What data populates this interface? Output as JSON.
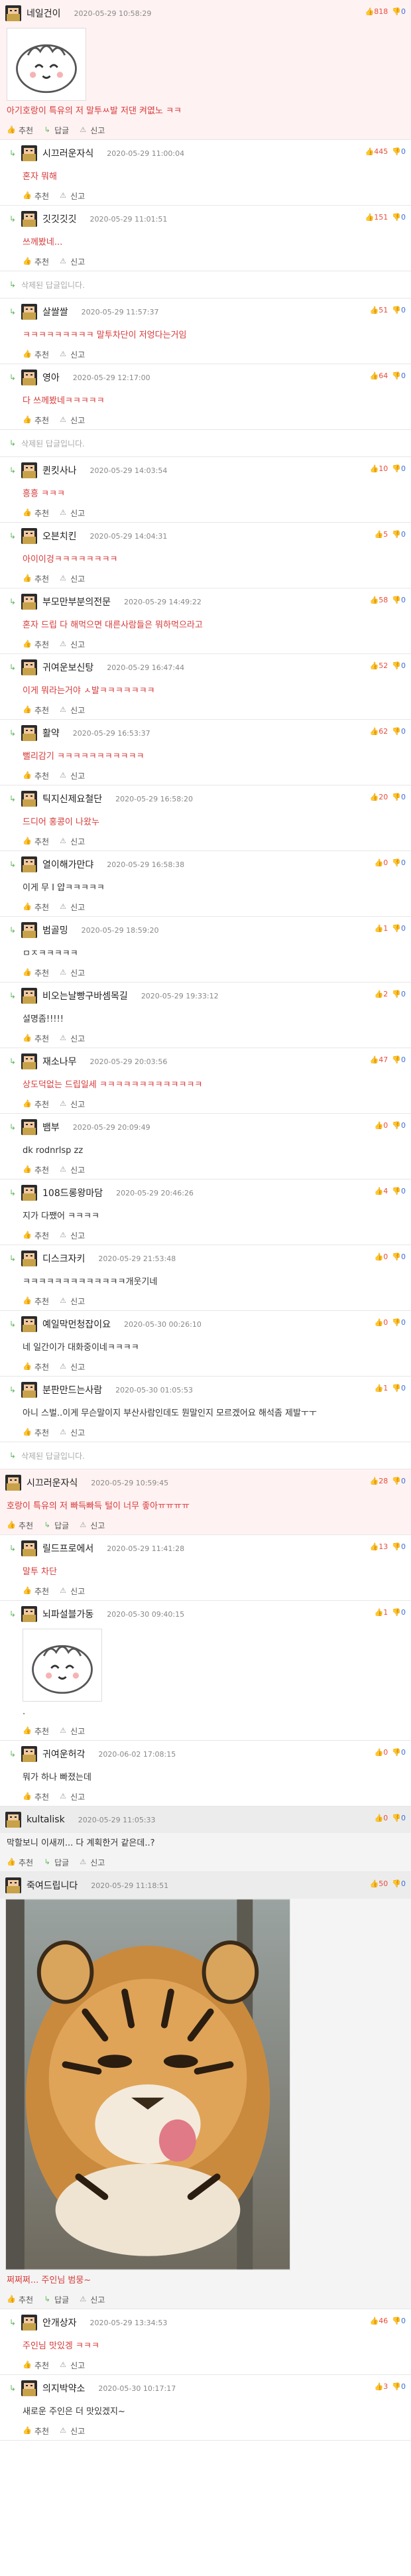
{
  "labels": {
    "recommend": "추천",
    "reply": "답글",
    "report": "신고",
    "deleted": "삭제된 답글입니다."
  },
  "colors": {
    "best_bg": "#fff2f2",
    "top_bg": "#f4f4f4",
    "up": "#e74c3c",
    "down": "#3a6fd8",
    "deleted_text": "#aaa"
  },
  "blocks": [
    {
      "kind": "comment",
      "variant": "best",
      "nick": "네일건이",
      "date": "2020-05-29 10:58:29",
      "score_up": "818",
      "score_down": "0",
      "image": "dumpling-sticker",
      "text": "아기호랑이 특유의 저 말투ㅆ발 저댄 켜엾노 ㅋㅋ",
      "text_color": "#d63a3a",
      "actions": "rec-reply-report"
    },
    {
      "kind": "comment",
      "variant": "reply",
      "nick": "시끄러운자식",
      "date": "2020-05-29 11:00:04",
      "score_up": "445",
      "score_down": "0",
      "text": "혼자 뭐해",
      "text_color": "#d63a3a",
      "actions": "rec-report"
    },
    {
      "kind": "comment",
      "variant": "reply",
      "nick": "깃깃깃깃",
      "date": "2020-05-29 11:01:51",
      "score_up": "151",
      "score_down": "0",
      "text": "쓰께봤네...",
      "text_color": "#d63a3a",
      "actions": "rec-report"
    },
    {
      "kind": "deleted",
      "variant": "reply"
    },
    {
      "kind": "comment",
      "variant": "reply",
      "nick": "살쌀쌀",
      "date": "2020-05-29 11:57:37",
      "score_up": "51",
      "score_down": "0",
      "text": "ㅋㅋㅋㅋㅋㅋㅋㅋㅋ 말투차단이 저엉다는거임",
      "text_color": "#d63a3a",
      "actions": "rec-report"
    },
    {
      "kind": "comment",
      "variant": "reply",
      "nick": "영아",
      "date": "2020-05-29 12:17:00",
      "score_up": "64",
      "score_down": "0",
      "text": "다 쓰께봤네ㅋㅋㅋㅋㅋ",
      "text_color": "#d63a3a",
      "actions": "rec-report"
    },
    {
      "kind": "deleted",
      "variant": "reply"
    },
    {
      "kind": "comment",
      "variant": "reply",
      "nick": "퀸킷사나",
      "date": "2020-05-29 14:03:54",
      "score_up": "10",
      "score_down": "0",
      "text": "흥흥 ㅋㅋㅋ",
      "text_color": "#d63a3a",
      "actions": "rec-report"
    },
    {
      "kind": "comment",
      "variant": "reply",
      "nick": "오븐치킨",
      "date": "2020-05-29 14:04:31",
      "score_up": "5",
      "score_down": "0",
      "text": "아이이겅ㅋㅋㅋㅋㅋㅋㅋㅋ",
      "text_color": "#d63a3a",
      "actions": "rec-report"
    },
    {
      "kind": "comment",
      "variant": "reply",
      "nick": "부모만부분의전문",
      "date": "2020-05-29 14:49:22",
      "score_up": "58",
      "score_down": "0",
      "text": "혼자 드립 다 해먹으면 대른사람들은 뭐하먹으라고",
      "text_color": "#d63a3a",
      "actions": "rec-report"
    },
    {
      "kind": "comment",
      "variant": "reply",
      "nick": "귀여운보신탕",
      "date": "2020-05-29 16:47:44",
      "score_up": "52",
      "score_down": "0",
      "text": "이게 뭐라는거야 ㅅ발ㅋㅋㅋㅋㅋㅋㅋ",
      "text_color": "#d63a3a",
      "actions": "rec-report"
    },
    {
      "kind": "comment",
      "variant": "reply",
      "nick": "활약",
      "date": "2020-05-29 16:53:37",
      "score_up": "62",
      "score_down": "0",
      "text": "뻘리감기 ㅋㅋㅋㅋㅋㅋㅋㅋㅋㅋㅋ",
      "text_color": "#d63a3a",
      "actions": "rec-report"
    },
    {
      "kind": "comment",
      "variant": "reply",
      "nick": "틱지신제요철단",
      "date": "2020-05-29 16:58:20",
      "score_up": "20",
      "score_down": "0",
      "text": "드디어 홍콩이 나왔누",
      "text_color": "#d63a3a",
      "actions": "rec-report"
    },
    {
      "kind": "comment",
      "variant": "reply",
      "nick": "열이해가만댜",
      "date": "2020-05-29 16:58:38",
      "score_up": "0",
      "score_down": "0",
      "text": "이게 무 I 얍ㅋㅋㅋㅋㅋ",
      "text_color": "#333",
      "actions": "rec-report"
    },
    {
      "kind": "comment",
      "variant": "reply",
      "nick": "범골밍",
      "date": "2020-05-29 18:59:20",
      "score_up": "1",
      "score_down": "0",
      "text": "ㅁㅈㅋㅋㅋㅋㅋ",
      "text_color": "#333",
      "actions": "rec-report"
    },
    {
      "kind": "comment",
      "variant": "reply",
      "nick": "비오는날빵구바셈목길",
      "date": "2020-05-29 19:33:12",
      "score_up": "2",
      "score_down": "0",
      "text": "설명좀!!!!!",
      "text_color": "#333",
      "actions": "rec-report"
    },
    {
      "kind": "comment",
      "variant": "reply",
      "nick": "재소나무",
      "date": "2020-05-29 20:03:56",
      "score_up": "47",
      "score_down": "0",
      "text": "상도덕없는 드립일세 ㅋㅋㅋㅋㅋㅋㅋㅋㅋㅋㅋㅋㅋ",
      "text_color": "#d63a3a",
      "actions": "rec-report"
    },
    {
      "kind": "comment",
      "variant": "reply",
      "nick": "뱀부",
      "date": "2020-05-29 20:09:49",
      "score_up": "0",
      "score_down": "0",
      "text": "dk rodnrlsp zz",
      "text_color": "#333",
      "actions": "rec-report"
    },
    {
      "kind": "comment",
      "variant": "reply",
      "nick": "108드롱왕마담",
      "date": "2020-05-29 20:46:26",
      "score_up": "4",
      "score_down": "0",
      "text": "지가 다쨌어 ㅋㅋㅋㅋ",
      "text_color": "#333",
      "actions": "rec-report"
    },
    {
      "kind": "comment",
      "variant": "reply",
      "nick": "디스크자키",
      "date": "2020-05-29 21:53:48",
      "score_up": "0",
      "score_down": "0",
      "text": "ㅋㅋㅋㅋㅋㅋㅋㅋㅋㅋㅋㅋㅋ개웃기네",
      "text_color": "#333",
      "actions": "rec-report"
    },
    {
      "kind": "comment",
      "variant": "reply",
      "nick": "예일막먼청잡이요",
      "date": "2020-05-30 00:26:10",
      "score_up": "0",
      "score_down": "0",
      "text": "네 일간이가 대화중이네ㅋㅋㅋㅋ",
      "text_color": "#333",
      "actions": "rec-report"
    },
    {
      "kind": "comment",
      "variant": "reply",
      "nick": "분판만드는사람",
      "date": "2020-05-30 01:05:53",
      "score_up": "1",
      "score_down": "0",
      "text": "아니 스벌..이게 무슨말이지 부산사람인데도 뭔말인지 모르겠어요 해석좀 제발ㅜㅜ",
      "text_color": "#333",
      "actions": "rec-report"
    },
    {
      "kind": "deleted",
      "variant": "reply"
    },
    {
      "kind": "comment",
      "variant": "best",
      "nick": "시끄러운자식",
      "date": "2020-05-29 10:59:45",
      "score_up": "28",
      "score_down": "0",
      "text": "호랑이 특유의 저 빠득빠득 털이 너무 좋아ㅠㅠㅠㅠ",
      "text_color": "#d63a3a",
      "actions": "rec-reply-report"
    },
    {
      "kind": "comment",
      "variant": "reply",
      "nick": "릴드프로에서",
      "date": "2020-05-29 11:41:28",
      "score_up": "13",
      "score_down": "0",
      "text": "말투 차단",
      "text_color": "#d63a3a",
      "actions": "rec-report"
    },
    {
      "kind": "comment",
      "variant": "reply",
      "nick": "뇌파설블가동",
      "date": "2020-05-30 09:40:15",
      "score_up": "1",
      "score_down": "0",
      "image": "dumpling-sticker",
      "text": ".",
      "text_color": "#333",
      "actions": "rec-report"
    },
    {
      "kind": "comment",
      "variant": "reply",
      "nick": "귀여운허각",
      "date": "2020-06-02 17:08:15",
      "score_up": "0",
      "score_down": "0",
      "text": "뭐가 하나 빠졌는데",
      "text_color": "#333",
      "actions": "rec-report"
    },
    {
      "kind": "comment",
      "variant": "top",
      "nick": "kultalisk",
      "date": "2020-05-29 11:05:33",
      "score_up": "0",
      "score_down": "0",
      "text": "막할보니 이새끼... 다 계획한거 같은데..?",
      "text_color": "#333",
      "actions": "rec-reply-report"
    },
    {
      "kind": "comment",
      "variant": "top",
      "nick": "죽여드립니다",
      "date": "2020-05-29 11:18:51",
      "score_up": "50",
      "score_down": "0",
      "image": "tiger-cub-photo",
      "text": "쩌쩌쩌... 주인님 범뭉~",
      "text_color": "#d63a3a",
      "actions": "rec-reply-report"
    },
    {
      "kind": "comment",
      "variant": "reply",
      "nick": "안개상자",
      "date": "2020-05-29 13:34:53",
      "score_up": "46",
      "score_down": "0",
      "text": "주인님 맛있겡 ㅋㅋㅋ",
      "text_color": "#d63a3a",
      "actions": "rec-report"
    },
    {
      "kind": "comment",
      "variant": "reply",
      "nick": "의지박약소",
      "date": "2020-05-30 10:17:17",
      "score_up": "3",
      "score_down": "0",
      "text": "새로운 주인은 더 맛있겠지~",
      "text_color": "#333",
      "actions": "rec-report"
    }
  ]
}
